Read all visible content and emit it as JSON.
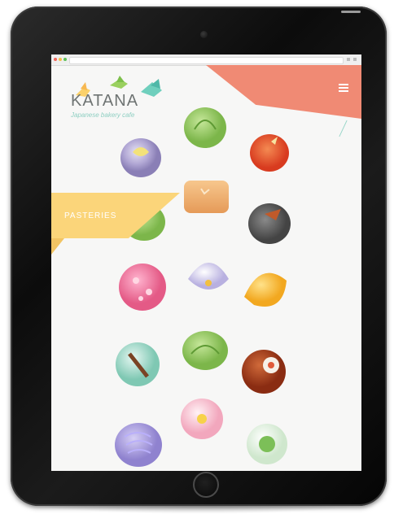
{
  "brand": {
    "name": "KATANA",
    "tagline": "Japanese bakery cafe",
    "colors": {
      "coral": "#f08a74",
      "yellow": "#fbd57a",
      "teal": "#6fcfbd"
    }
  },
  "nav": {
    "menu_icon": "hamburger-icon",
    "section_label": "PASTERIES"
  },
  "device": {
    "type": "tablet"
  }
}
